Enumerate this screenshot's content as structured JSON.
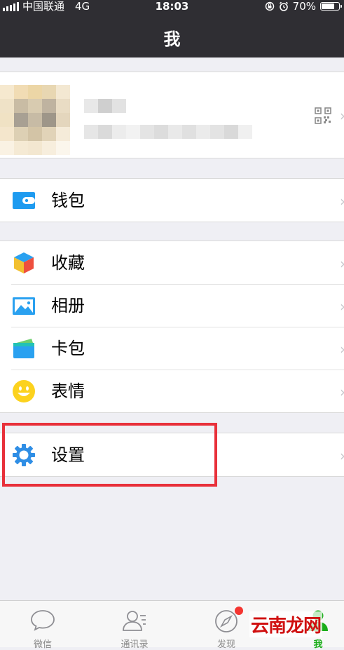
{
  "status_bar": {
    "carrier": "中国联通",
    "network": "4G",
    "time": "18:03",
    "battery": "70%"
  },
  "nav": {
    "title": "我"
  },
  "profile": {
    "qr_icon": "qr-code-icon"
  },
  "wallet": {
    "label": "钱包",
    "icon": "wallet-icon",
    "color": "#1e9bf0"
  },
  "menu": [
    {
      "label": "收藏",
      "icon": "favorites-cube-icon"
    },
    {
      "label": "相册",
      "icon": "album-icon"
    },
    {
      "label": "卡包",
      "icon": "card-wallet-icon"
    },
    {
      "label": "表情",
      "icon": "sticker-smile-icon"
    }
  ],
  "settings": {
    "label": "设置",
    "icon": "gear-icon",
    "color": "#2f8ee5"
  },
  "tabs": [
    {
      "label": "微信",
      "icon": "chat-bubble-icon",
      "active": false
    },
    {
      "label": "通讯录",
      "icon": "contacts-icon",
      "active": false
    },
    {
      "label": "发现",
      "icon": "compass-icon",
      "active": false,
      "badge": true
    },
    {
      "label": "我",
      "icon": "person-icon",
      "active": true
    }
  ],
  "watermark": {
    "text": "云南龙网"
  },
  "colors": {
    "accent_green": "#1aad19",
    "highlight_red": "#e8303a",
    "header_bg": "#2f2e33"
  }
}
